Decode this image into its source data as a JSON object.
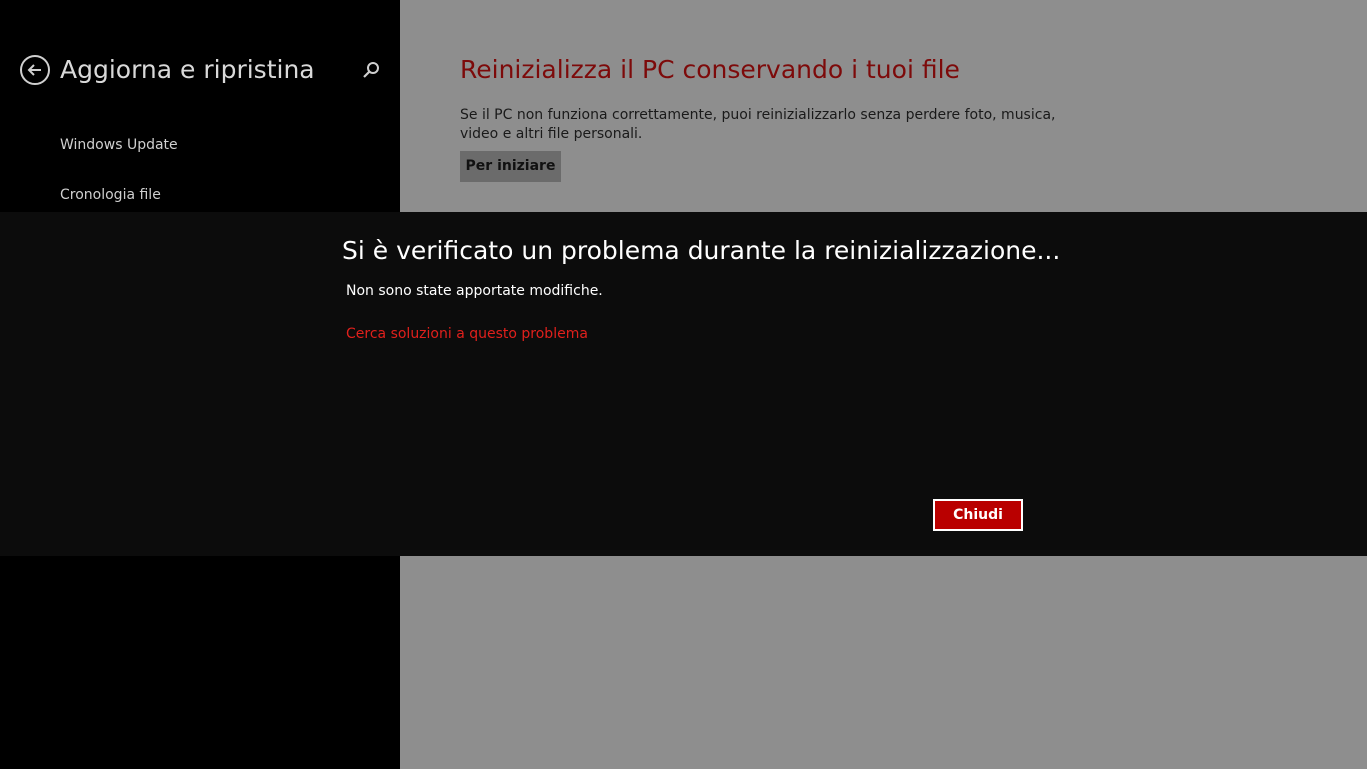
{
  "sidebar": {
    "title": "Aggiorna e ripristina",
    "back_icon": "back-arrow-icon",
    "search_icon": "search-icon",
    "items": [
      {
        "label": "Windows Update"
      },
      {
        "label": "Cronologia file"
      }
    ]
  },
  "main": {
    "section_title": "Reinizializza il PC conservando i tuoi file",
    "section_description": "Se il PC non funziona correttamente, puoi reinizializzarlo senza perdere foto, musica, video e altri file personali.",
    "start_button_label": "Per iniziare"
  },
  "dialog": {
    "title": "Si è verificato un problema durante la reinizializzazione...",
    "message": "Non sono state apportate modifiche.",
    "link_label": "Cerca soluzioni a questo problema",
    "close_button_label": "Chiudi"
  },
  "colors": {
    "accent_red": "#b90000",
    "link_red": "#e0201c",
    "section_title_red": "#7d0a0a",
    "sidebar_bg": "#000000",
    "dialog_bg": "#0c0c0c",
    "content_bg": "#8e8e8e"
  }
}
